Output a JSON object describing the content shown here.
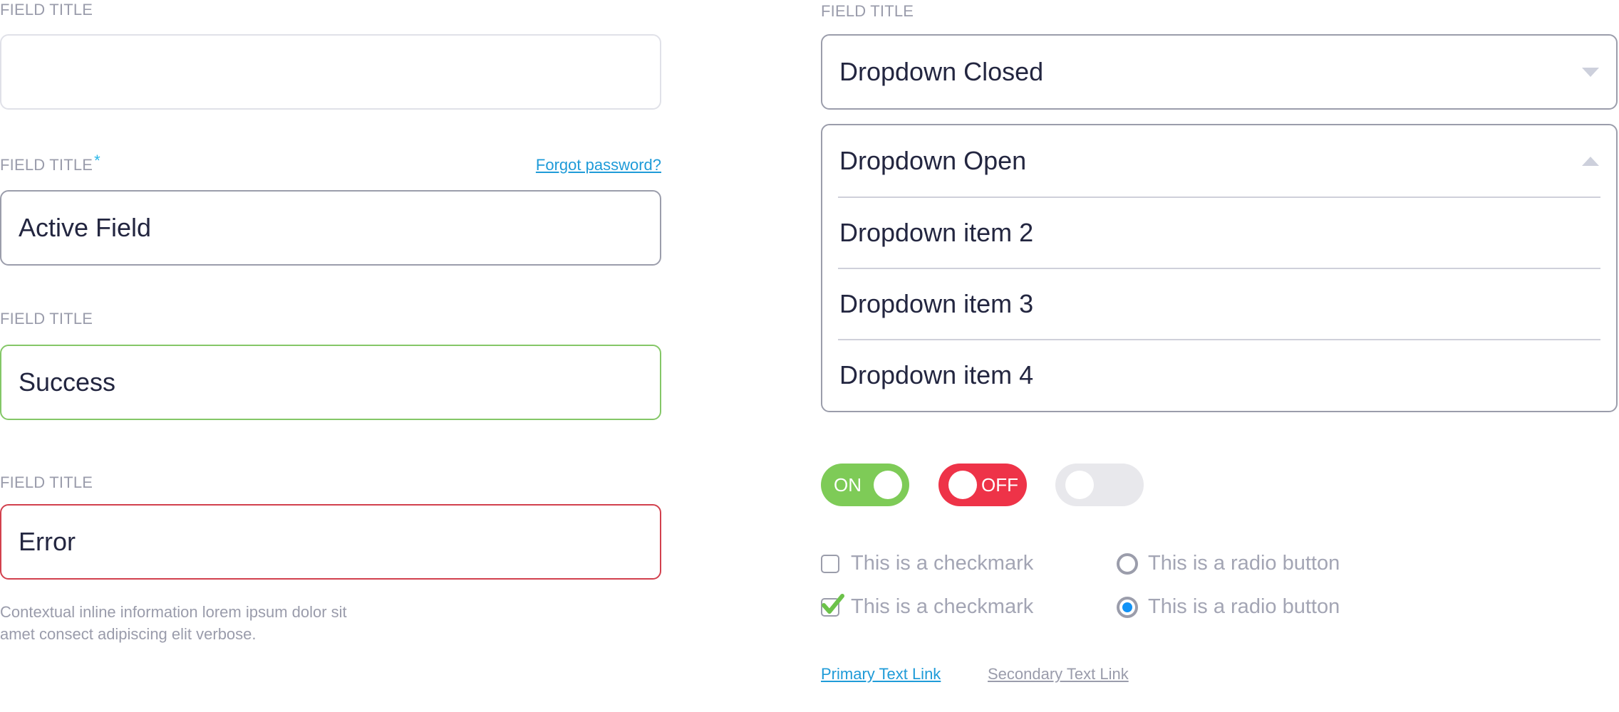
{
  "colors": {
    "label": "#9a9cab",
    "text": "#232640",
    "required_asterisk": "#29b6e8",
    "primary_link": "#1f9bd8",
    "success": "#84c767",
    "error": "#d2404d",
    "toggle_on": "#7ecb57",
    "toggle_off": "#ee3348",
    "toggle_disabled": "#e8e8ec",
    "radio_selected": "#1192f6",
    "checkmark": "#6cc24a"
  },
  "left_column": {
    "empty_field": {
      "label": "FIELD TITLE",
      "value": ""
    },
    "active_field": {
      "label": "FIELD TITLE",
      "required_marker": "*",
      "link": "Forgot password?",
      "value": "Active Field"
    },
    "success_field": {
      "label": "FIELD TITLE",
      "value": "Success"
    },
    "error_field": {
      "label": "FIELD TITLE",
      "value": "Error"
    },
    "helper_text_line1": "Contextual inline information lorem ipsum dolor sit",
    "helper_text_line2": "amet consect adipiscing elit verbose."
  },
  "right_column": {
    "dropdown_label": "FIELD TITLE",
    "dropdown_closed": {
      "value": "Dropdown Closed",
      "icon": "caret-down-icon"
    },
    "dropdown_open": {
      "value": "Dropdown Open",
      "icon": "caret-up-icon",
      "items": [
        "Dropdown item 2",
        "Dropdown item 3",
        "Dropdown item 4"
      ]
    },
    "toggles": [
      {
        "state": "on",
        "label": "ON"
      },
      {
        "state": "off",
        "label": "OFF"
      },
      {
        "state": "disabled",
        "label": ""
      }
    ],
    "checkboxes": [
      {
        "label": "This is a checkmark",
        "checked": false
      },
      {
        "label": "This is a checkmark",
        "checked": true
      }
    ],
    "radios": [
      {
        "label": "This is a radio button",
        "selected": false
      },
      {
        "label": "This is a radio button",
        "selected": true
      }
    ],
    "links": {
      "primary": "Primary Text Link",
      "secondary": "Secondary Text Link"
    }
  }
}
